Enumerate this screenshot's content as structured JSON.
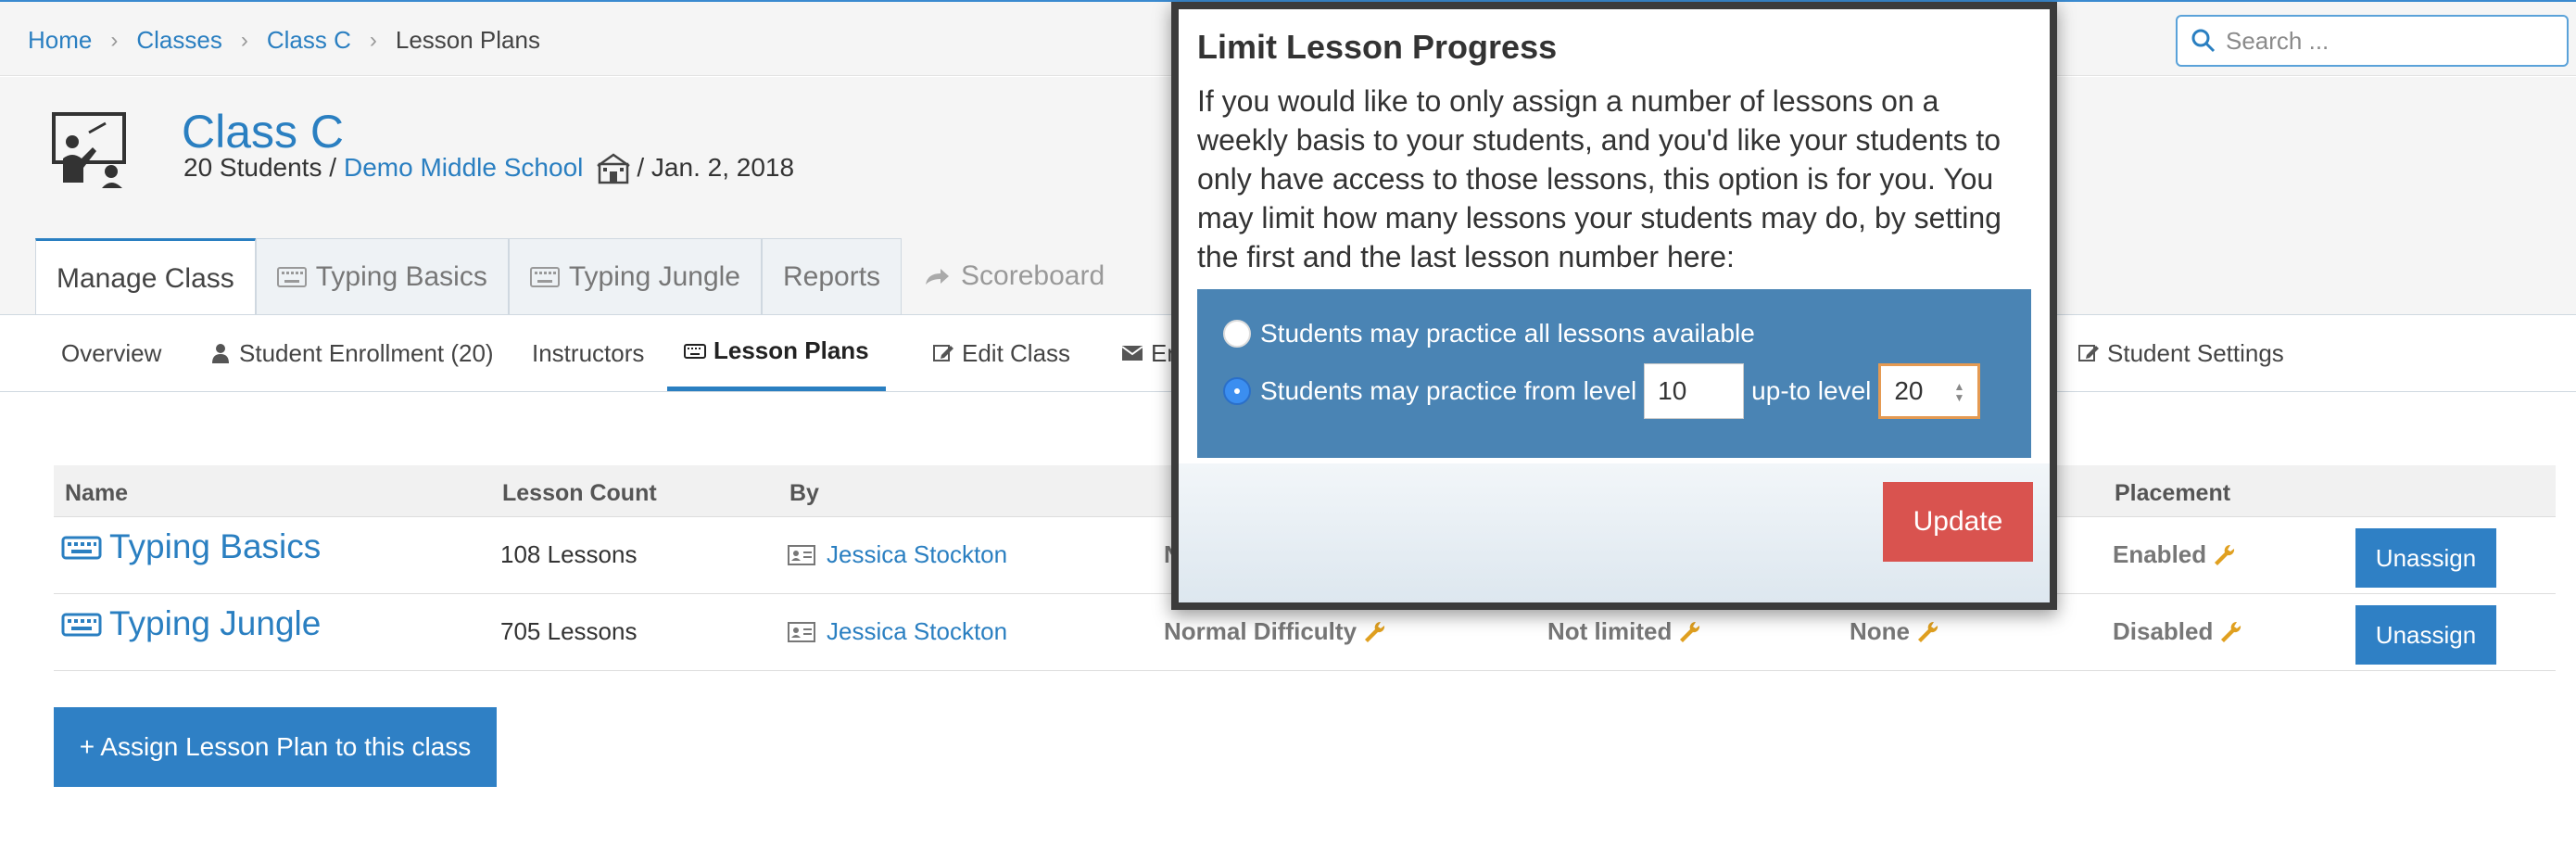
{
  "breadcrumb": {
    "items": [
      {
        "label": "Home"
      },
      {
        "label": "Classes"
      },
      {
        "label": "Class C"
      },
      {
        "label": "Lesson Plans"
      }
    ]
  },
  "search": {
    "placeholder": "Search ..."
  },
  "class_info": {
    "title": "Class C",
    "students": "20 Students /",
    "school": "Demo Middle School",
    "date": "/ Jan. 2, 2018"
  },
  "main_tabs": [
    {
      "label": "Manage Class",
      "icon": "none"
    },
    {
      "label": "Typing Basics",
      "icon": "keyboard-icon"
    },
    {
      "label": "Typing Jungle",
      "icon": "keyboard-icon"
    },
    {
      "label": "Reports",
      "icon": "none"
    },
    {
      "label": "Scoreboard",
      "icon": "share-icon"
    }
  ],
  "sub_nav": [
    {
      "label": "Overview"
    },
    {
      "label": "Student Enrollment (20)",
      "icon": "user-icon"
    },
    {
      "label": "Instructors"
    },
    {
      "label": "Lesson Plans",
      "icon": "keyboard-icon"
    },
    {
      "label": "Edit Class",
      "icon": "edit-icon"
    },
    {
      "label": "En",
      "icon": "envelope-icon"
    },
    {
      "label": "Student Settings",
      "icon": "edit-icon"
    }
  ],
  "table": {
    "headers": [
      "Name",
      "Lesson Count",
      "By",
      "Placement"
    ],
    "rows": [
      {
        "name": "Typing Basics",
        "count": "108 Lessons",
        "by": "Jessica Stockton",
        "difficulty": "N",
        "limit": "",
        "second": "",
        "placement": "Enabled",
        "action": "Unassign"
      },
      {
        "name": "Typing Jungle",
        "count": "705 Lessons",
        "by": "Jessica Stockton",
        "difficulty": "Normal Difficulty",
        "limit": "Not limited",
        "second": "None",
        "placement": "Disabled",
        "action": "Unassign"
      }
    ]
  },
  "assign_button": "+ Assign Lesson Plan to this class",
  "modal": {
    "title": "Limit Lesson Progress",
    "description": "If you would like to only assign a number of lessons on a weekly basis to your students, and you'd like your students to only have access to those lessons, this option is for you. You may limit how many lessons your students may do, by setting the first and the last lesson number here:",
    "option_all": "Students may practice all lessons available",
    "option_range_prefix": "Students may practice from level",
    "from_level": "10",
    "option_range_mid": "up-to level",
    "to_level": "20",
    "selected_option": "range",
    "update_label": "Update"
  },
  "colors": {
    "accent": "#2a7fc1",
    "options_bg": "#4a84b4",
    "update_button": "#d9534f",
    "wrench": "#e0a020"
  }
}
